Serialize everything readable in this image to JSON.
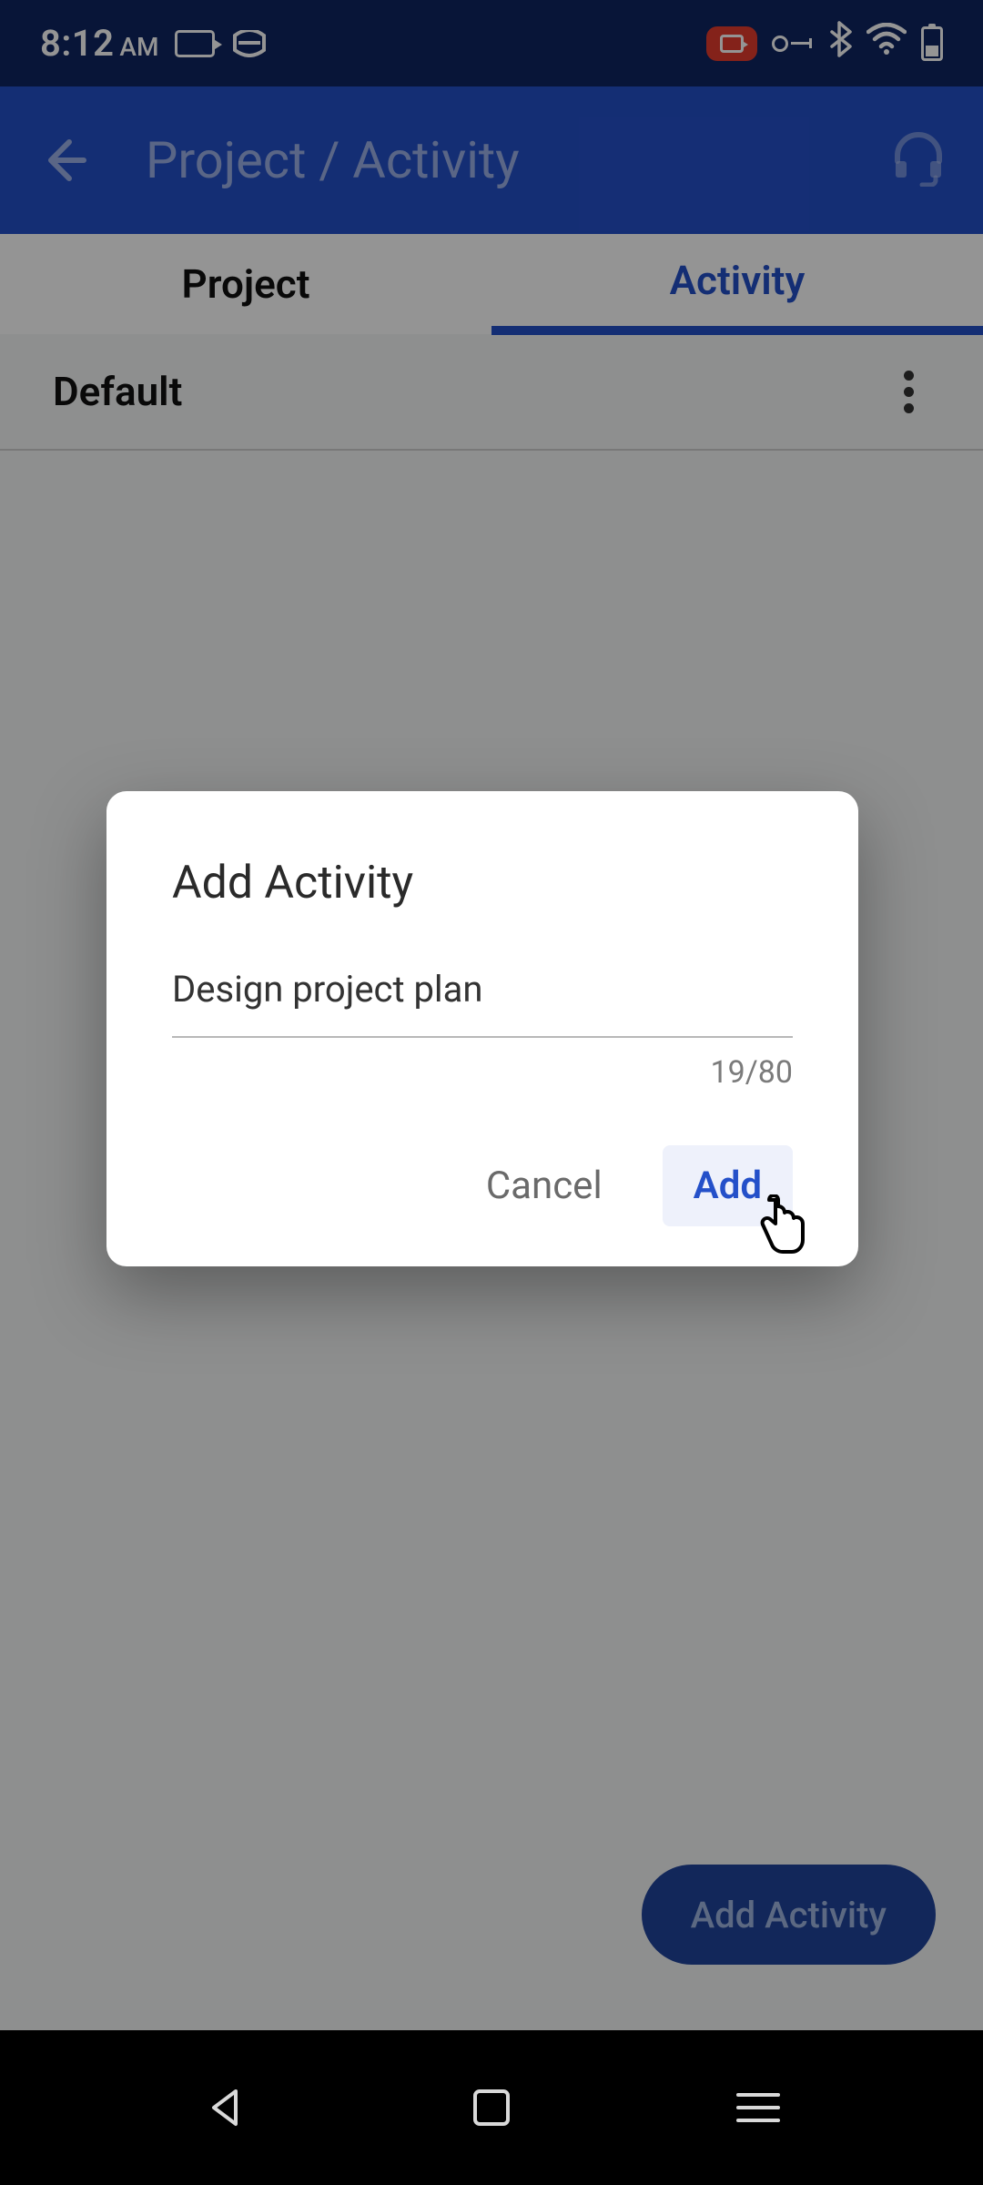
{
  "status": {
    "time": "8:12",
    "ampm": "AM"
  },
  "appbar": {
    "title": "Project / Activity"
  },
  "tabs": {
    "project": "Project",
    "activity": "Activity"
  },
  "list": {
    "row0": {
      "label": "Default"
    }
  },
  "fab": {
    "label": "Add Activity"
  },
  "dialog": {
    "title": "Add Activity",
    "input_value": "Design project plan",
    "counter": "19/80",
    "cancel": "Cancel",
    "add": "Add"
  }
}
